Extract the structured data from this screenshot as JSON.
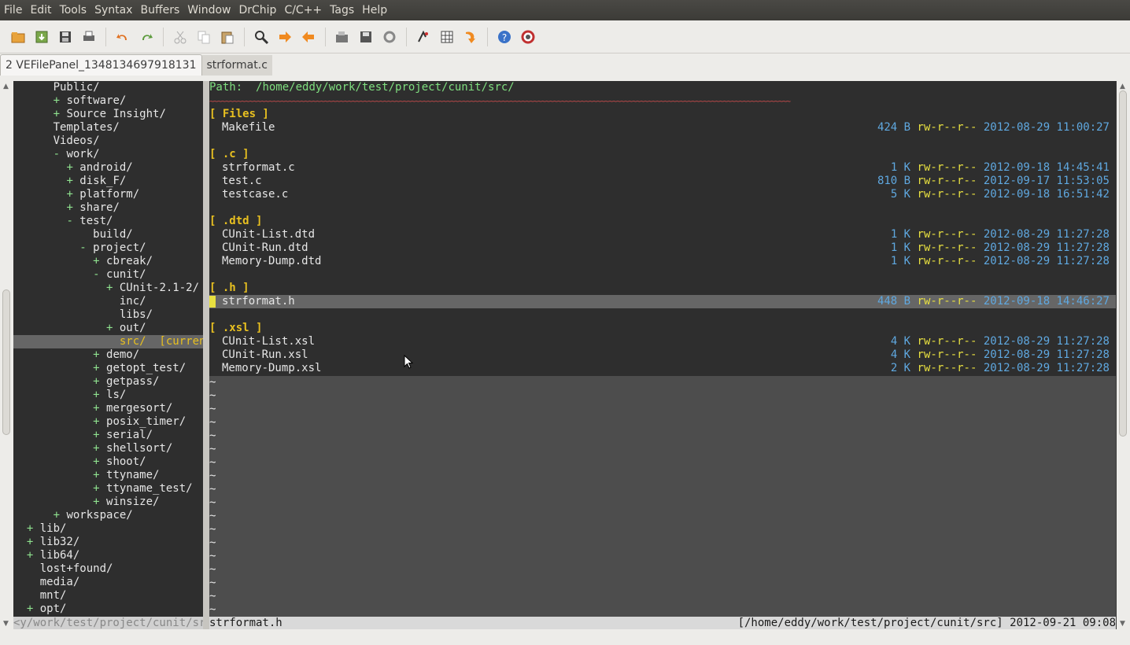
{
  "menubar": [
    "File",
    "Edit",
    "Tools",
    "Syntax",
    "Buffers",
    "Window",
    "DrChip",
    "C/C++",
    "Tags",
    "Help"
  ],
  "toolbar": {
    "icons": [
      "open-icon",
      "save-all-icon",
      "save-icon",
      "print-icon",
      "undo-icon",
      "redo-icon",
      "cut-icon",
      "copy-icon",
      "paste-icon",
      "find-replace-icon",
      "forward-icon",
      "back-icon",
      "load-session-icon",
      "save-session-icon",
      "run-script-icon",
      "make-icon",
      "table-icon",
      "jump-tag-icon",
      "help-icon",
      "find-help-icon"
    ]
  },
  "tabs": [
    {
      "label": "2 VEFilePanel_1348134697918131",
      "active": true
    },
    {
      "label": "strformat.c",
      "active": false
    }
  ],
  "tree": [
    {
      "indent": "    ",
      "marker": "  ",
      "name": "Public/"
    },
    {
      "indent": "      ",
      "marker": "+ ",
      "name": "software/"
    },
    {
      "indent": "      ",
      "marker": "+ ",
      "name": "Source Insight/"
    },
    {
      "indent": "    ",
      "marker": "  ",
      "name": "Templates/"
    },
    {
      "indent": "    ",
      "marker": "  ",
      "name": "Videos/"
    },
    {
      "indent": "      ",
      "marker": "- ",
      "name": "work/"
    },
    {
      "indent": "        ",
      "marker": "+ ",
      "name": "android/"
    },
    {
      "indent": "        ",
      "marker": "+ ",
      "name": "disk_F/"
    },
    {
      "indent": "        ",
      "marker": "+ ",
      "name": "platform/"
    },
    {
      "indent": "        ",
      "marker": "+ ",
      "name": "share/"
    },
    {
      "indent": "        ",
      "marker": "- ",
      "name": "test/"
    },
    {
      "indent": "          ",
      "marker": "  ",
      "name": "build/"
    },
    {
      "indent": "          ",
      "marker": "- ",
      "name": "project/"
    },
    {
      "indent": "            ",
      "marker": "+ ",
      "name": "cbreak/"
    },
    {
      "indent": "            ",
      "marker": "- ",
      "name": "cunit/"
    },
    {
      "indent": "              ",
      "marker": "+ ",
      "name": "CUnit-2.1-2/"
    },
    {
      "indent": "                ",
      "marker": "",
      "name": "inc/"
    },
    {
      "indent": "                ",
      "marker": "",
      "name": "libs/"
    },
    {
      "indent": "              ",
      "marker": "+ ",
      "name": "out/"
    },
    {
      "indent": "                ",
      "marker": "",
      "name": "src/",
      "current": true,
      "tag": "  [current"
    },
    {
      "indent": "            ",
      "marker": "+ ",
      "name": "demo/"
    },
    {
      "indent": "            ",
      "marker": "+ ",
      "name": "getopt_test/"
    },
    {
      "indent": "            ",
      "marker": "+ ",
      "name": "getpass/"
    },
    {
      "indent": "            ",
      "marker": "+ ",
      "name": "ls/"
    },
    {
      "indent": "            ",
      "marker": "+ ",
      "name": "mergesort/"
    },
    {
      "indent": "            ",
      "marker": "+ ",
      "name": "posix_timer/"
    },
    {
      "indent": "            ",
      "marker": "+ ",
      "name": "serial/"
    },
    {
      "indent": "            ",
      "marker": "+ ",
      "name": "shellsort/"
    },
    {
      "indent": "            ",
      "marker": "+ ",
      "name": "shoot/"
    },
    {
      "indent": "            ",
      "marker": "+ ",
      "name": "ttyname/"
    },
    {
      "indent": "            ",
      "marker": "+ ",
      "name": "ttyname_test/"
    },
    {
      "indent": "            ",
      "marker": "+ ",
      "name": "winsize/"
    },
    {
      "indent": "      ",
      "marker": "+ ",
      "name": "workspace/"
    },
    {
      "indent": "  ",
      "marker": "+ ",
      "name": "lib/"
    },
    {
      "indent": "  ",
      "marker": "+ ",
      "name": "lib32/"
    },
    {
      "indent": "  ",
      "marker": "+ ",
      "name": "lib64/"
    },
    {
      "indent": "    ",
      "marker": "",
      "name": "lost+found/"
    },
    {
      "indent": "    ",
      "marker": "",
      "name": "media/"
    },
    {
      "indent": "    ",
      "marker": "",
      "name": "mnt/"
    },
    {
      "indent": "  ",
      "marker": "+ ",
      "name": "opt/"
    }
  ],
  "filepanel": {
    "path_label": "Path:",
    "path": "/home/eddy/work/test/project/cunit/src/",
    "wave": "~~~~~~~~~~~~~~~~~~~~~~~~~~~~~~~~~~~~~~~~~~~~~~~~~~~~~~~~~~~~~~~~~~~~~~~~~~~~~~~~~~~~~~~~~~~~~~~~~~~~~~~~~~~~~~~~~~~~~~~~~~~~~~~~~~~~~~~~~~~~~~~~~~~",
    "sections": [
      {
        "title": "[ Files ]",
        "files": [
          {
            "name": "Makefile",
            "size": "424 B",
            "perm": "rw-r--r--",
            "date": "2012-08-29 11:00:27"
          }
        ]
      },
      {
        "title": "[ .c ]",
        "files": [
          {
            "name": "strformat.c",
            "size": "1 K",
            "perm": "rw-r--r--",
            "date": "2012-09-18 14:45:41"
          },
          {
            "name": "test.c",
            "size": "810 B",
            "perm": "rw-r--r--",
            "date": "2012-09-17 11:53:05"
          },
          {
            "name": "testcase.c",
            "size": "5 K",
            "perm": "rw-r--r--",
            "date": "2012-09-18 16:51:42"
          }
        ]
      },
      {
        "title": "[ .dtd ]",
        "files": [
          {
            "name": "CUnit-List.dtd",
            "size": "1 K",
            "perm": "rw-r--r--",
            "date": "2012-08-29 11:27:28"
          },
          {
            "name": "CUnit-Run.dtd",
            "size": "1 K",
            "perm": "rw-r--r--",
            "date": "2012-08-29 11:27:28"
          },
          {
            "name": "Memory-Dump.dtd",
            "size": "1 K",
            "perm": "rw-r--r--",
            "date": "2012-08-29 11:27:28"
          }
        ]
      },
      {
        "title": "[ .h ]",
        "files": [
          {
            "name": "strformat.h",
            "size": "448 B",
            "perm": "rw-r--r--",
            "date": "2012-09-18 14:46:27",
            "selected": true
          }
        ]
      },
      {
        "title": "[ .xsl ]",
        "files": [
          {
            "name": "CUnit-List.xsl",
            "size": "4 K",
            "perm": "rw-r--r--",
            "date": "2012-08-29 11:27:28"
          },
          {
            "name": "CUnit-Run.xsl",
            "size": "4 K",
            "perm": "rw-r--r--",
            "date": "2012-08-29 11:27:28"
          },
          {
            "name": "Memory-Dump.xsl",
            "size": "2 K",
            "perm": "rw-r--r--",
            "date": "2012-08-29 11:27:28"
          }
        ]
      }
    ],
    "tilde": "~",
    "tilde_count": 18
  },
  "statusline": {
    "left": "<y/work/test/project/cunit/src",
    "file": "strformat.h",
    "right": "[/home/eddy/work/test/project/cunit/src] 2012-09-21 09:08"
  },
  "colors": {
    "accent": "#e8e040",
    "dir_marker": "#8fe28f",
    "info": "#5fa8e0",
    "section": "#e8c020"
  }
}
